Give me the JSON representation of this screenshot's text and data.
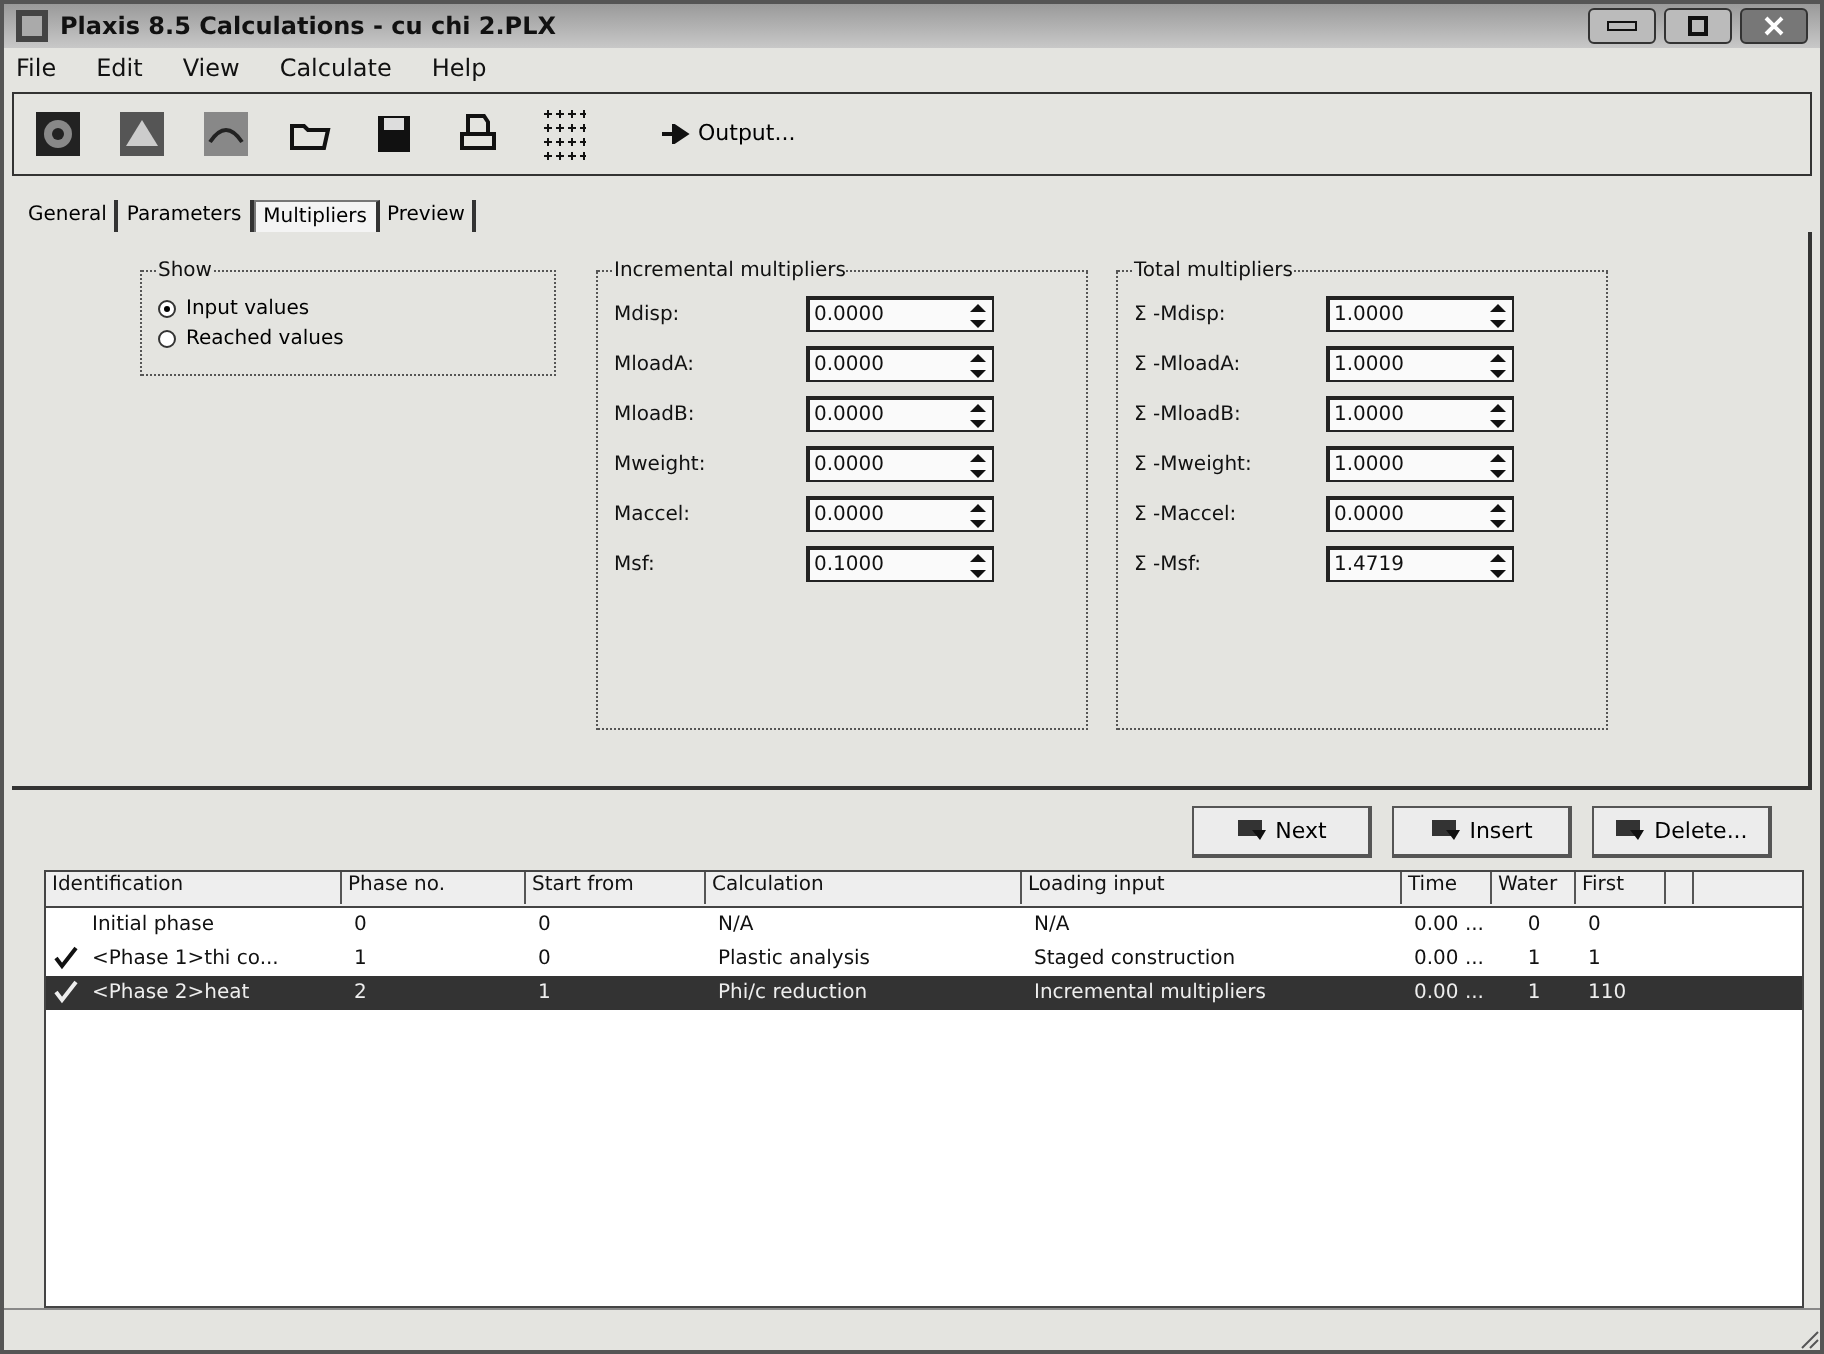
{
  "window": {
    "title": "Plaxis 8.5 Calculations - cu chi 2.PLX"
  },
  "menu": [
    "File",
    "Edit",
    "View",
    "Calculate",
    "Help"
  ],
  "toolbar": {
    "output_button": "Output..."
  },
  "tabs": [
    {
      "label": "General",
      "selected": false
    },
    {
      "label": "Parameters",
      "selected": false
    },
    {
      "label": "Multipliers",
      "selected": true
    },
    {
      "label": "Preview",
      "selected": false
    }
  ],
  "show": {
    "title": "Show",
    "options": [
      {
        "label": "Input values",
        "selected": true
      },
      {
        "label": "Reached values",
        "selected": false
      }
    ]
  },
  "incremental_multipliers": {
    "title": "Incremental multipliers",
    "fields": [
      {
        "label": "Mdisp:",
        "value": "0.0000"
      },
      {
        "label": "MloadA:",
        "value": "0.0000"
      },
      {
        "label": "MloadB:",
        "value": "0.0000"
      },
      {
        "label": "Mweight:",
        "value": "0.0000"
      },
      {
        "label": "Maccel:",
        "value": "0.0000"
      },
      {
        "label": "Msf:",
        "value": "0.1000"
      }
    ]
  },
  "total_multipliers": {
    "title": "Total multipliers",
    "fields": [
      {
        "label": "Σ -Mdisp:",
        "value": "1.0000"
      },
      {
        "label": "Σ -MloadA:",
        "value": "1.0000"
      },
      {
        "label": "Σ -MloadB:",
        "value": "1.0000"
      },
      {
        "label": "Σ -Mweight:",
        "value": "1.0000"
      },
      {
        "label": "Σ -Maccel:",
        "value": "0.0000"
      },
      {
        "label": "Σ -Msf:",
        "value": "1.4719"
      }
    ]
  },
  "buttons": [
    "Next",
    "Insert",
    "Delete..."
  ],
  "table": {
    "columns": [
      "Identification",
      "Phase no.",
      "Start from",
      "Calculation",
      "Loading input",
      "Time",
      "Water",
      "First"
    ],
    "rows": [
      {
        "checked": false,
        "selected": false,
        "cells": [
          "Initial phase",
          "0",
          "0",
          "N/A",
          "N/A",
          "0.00 ...",
          "0",
          "0"
        ]
      },
      {
        "checked": true,
        "selected": false,
        "cells": [
          "<Phase 1>thi co...",
          "1",
          "0",
          "Plastic analysis",
          "Staged construction",
          "0.00 ...",
          "1",
          "1"
        ]
      },
      {
        "checked": true,
        "selected": true,
        "cells": [
          "<Phase 2>heat",
          "2",
          "1",
          "Phi/c reduction",
          "Incremental multipliers",
          "0.00 ...",
          "1",
          "110"
        ]
      }
    ]
  }
}
